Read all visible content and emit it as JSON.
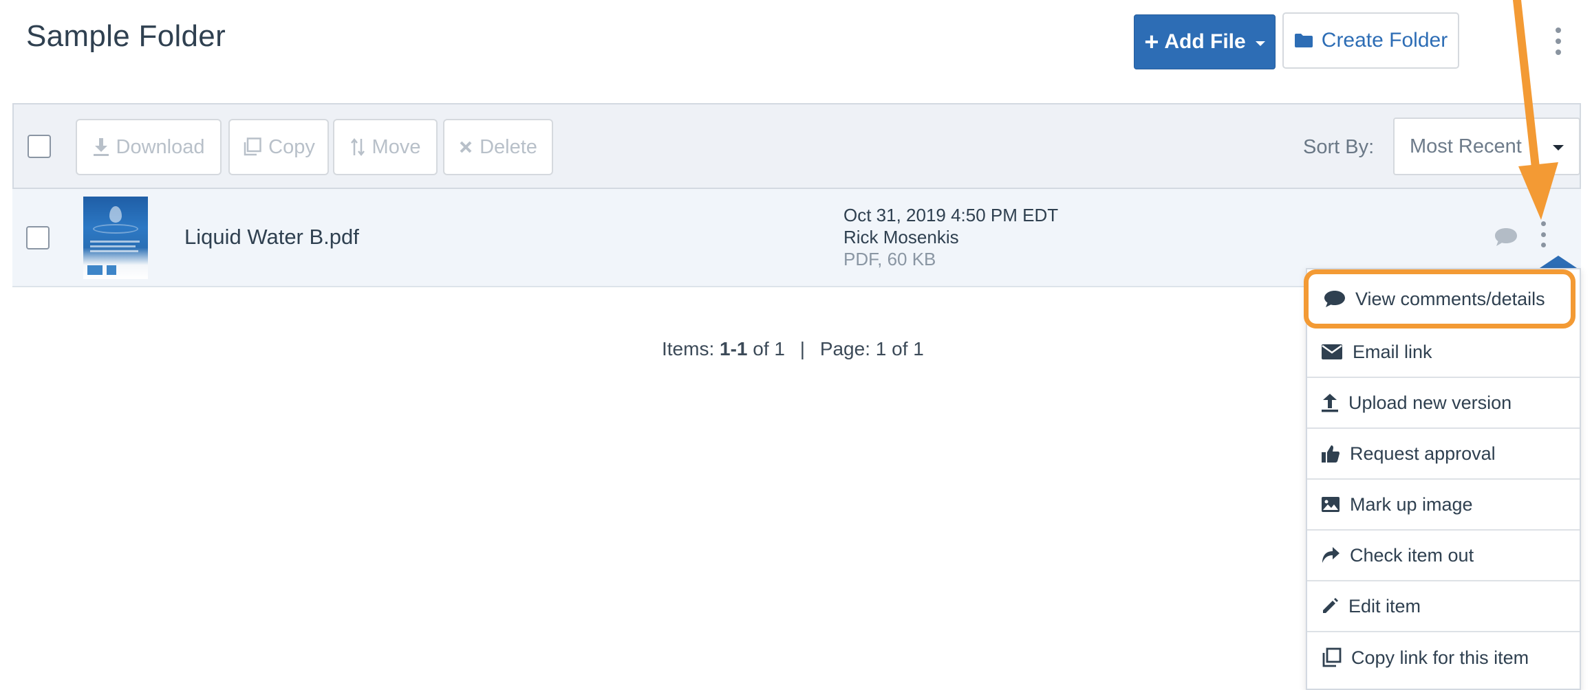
{
  "header": {
    "title": "Sample Folder",
    "add_file_label": "Add File",
    "create_folder_label": "Create Folder"
  },
  "toolbar": {
    "download_label": "Download",
    "copy_label": "Copy",
    "move_label": "Move",
    "delete_label": "Delete",
    "sort_label": "Sort By:",
    "sort_value": "Most Recent"
  },
  "file": {
    "name": "Liquid Water B.pdf",
    "date": "Oct 31, 2019 4:50 PM EDT",
    "author": "Rick Mosenkis",
    "type_size": "PDF, 60 KB"
  },
  "pager": {
    "items_label": "Items: ",
    "items_range": "1-1",
    "items_total": " of 1",
    "separator": "|",
    "page_text": "Page: 1 of 1"
  },
  "menu": {
    "items": [
      {
        "label": "View comments/details",
        "icon": "comment-icon"
      },
      {
        "label": "Email link",
        "icon": "envelope-icon"
      },
      {
        "label": "Upload new version",
        "icon": "upload-icon"
      },
      {
        "label": "Request approval",
        "icon": "thumbs-up-icon"
      },
      {
        "label": "Mark up image",
        "icon": "image-icon"
      },
      {
        "label": "Check item out",
        "icon": "share-arrow-icon"
      },
      {
        "label": "Edit item",
        "icon": "pencil-icon"
      },
      {
        "label": "Copy link for this item",
        "icon": "copy-icon"
      }
    ]
  },
  "colors": {
    "primary": "#2d6db5",
    "highlight": "#f39a34",
    "arrow": "#f39a34"
  }
}
